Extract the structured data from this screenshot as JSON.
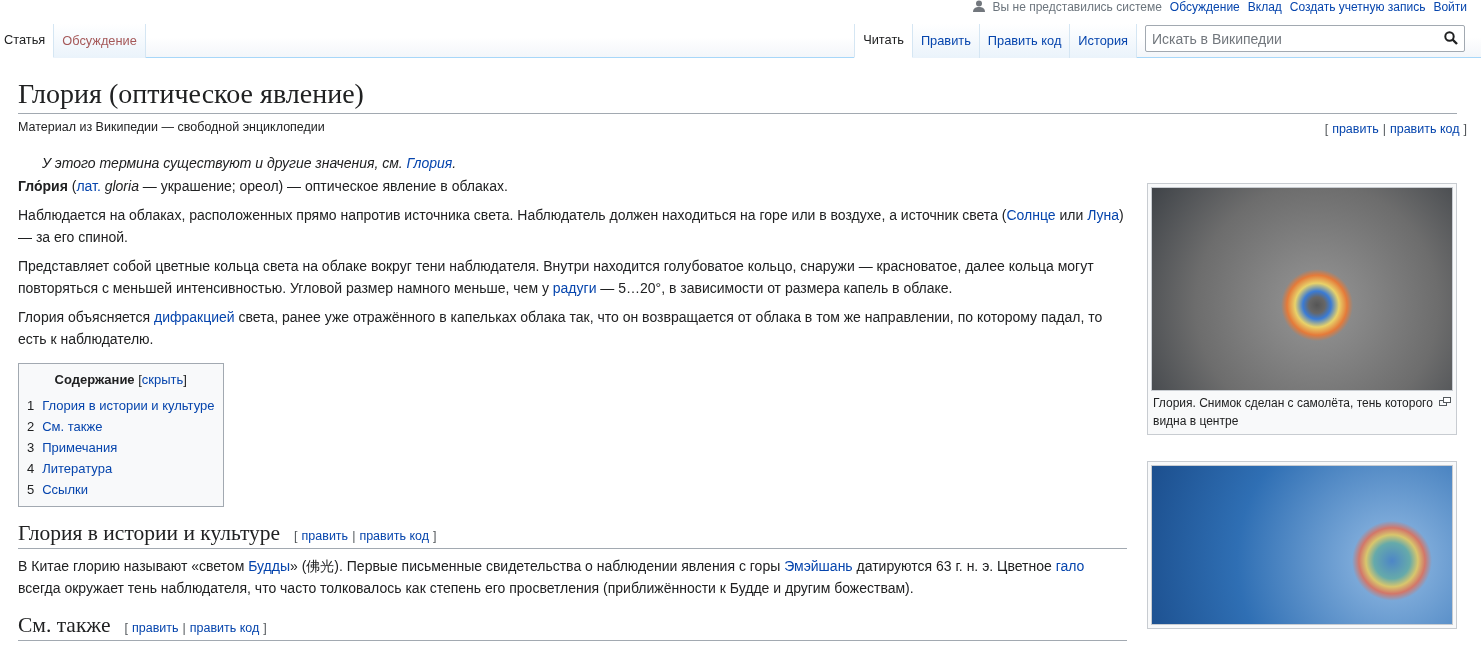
{
  "personal_bar": {
    "status": "Вы не представились системе",
    "links": [
      "Обсуждение",
      "Вклад",
      "Создать учетную запись",
      "Войти"
    ]
  },
  "namespace_tabs": [
    {
      "label": "Статья",
      "selected": true,
      "new_page": false
    },
    {
      "label": "Обсуждение",
      "selected": false,
      "new_page": true
    }
  ],
  "view_tabs": [
    {
      "label": "Читать",
      "selected": true
    },
    {
      "label": "Править",
      "selected": false
    },
    {
      "label": "Править код",
      "selected": false
    },
    {
      "label": "История",
      "selected": false
    }
  ],
  "search": {
    "placeholder": "Искать в Википедии"
  },
  "article": {
    "title": "Глория (оптическое явление)",
    "tagline": "Материал из Википедии — свободной энциклопедии",
    "edit_links": {
      "open": "[",
      "links": [
        "править",
        "править код"
      ],
      "separator": "|",
      "close": "]"
    },
    "hatnote": [
      {
        "kind": "text",
        "text": "У этого термина существуют и другие значения, см. "
      },
      {
        "kind": "link",
        "text": "Глория"
      },
      {
        "kind": "text",
        "text": "."
      }
    ],
    "paragraphs": [
      [
        {
          "kind": "text",
          "text": "**Гло́рия** ("
        },
        {
          "kind": "link",
          "text": "лат."
        },
        {
          "kind": "text",
          "text": " *gloria* — украшение; ореол) — оптическое явление в облаках."
        }
      ],
      [
        {
          "kind": "text",
          "text": "Наблюдается на облаках, расположенных прямо напротив источника света. Наблюдатель должен находиться на горе или в воздухе, а источник света ("
        },
        {
          "kind": "link",
          "text": "Солнце"
        },
        {
          "kind": "text",
          "text": " или "
        },
        {
          "kind": "link",
          "text": "Луна"
        },
        {
          "kind": "text",
          "text": ") — за его спиной."
        }
      ],
      [
        {
          "kind": "text",
          "text": "Представляет собой цветные кольца света на облаке вокруг тени наблюдателя. Внутри находится голубоватое кольцо, снаружи — красноватое, далее кольца могут повторяться с меньшей интенсивностью. Угловой размер намного меньше, чем у "
        },
        {
          "kind": "link",
          "text": "радуги"
        },
        {
          "kind": "text",
          "text": " — 5…20°, в зависимости от размера капель в облаке."
        }
      ],
      [
        {
          "kind": "text",
          "text": "Глория объясняется "
        },
        {
          "kind": "link",
          "text": "дифракцией"
        },
        {
          "kind": "text",
          "text": " света, ранее уже отражённого в капельках облака так, что он возвращается от облака в том же направлении, по которому падал, то есть к наблюдателю."
        }
      ]
    ],
    "toc": {
      "title": "Содержание",
      "open": "[",
      "toggle": "скрыть",
      "close": "]",
      "items": [
        {
          "number": "1",
          "label": "Глория в истории и культуре"
        },
        {
          "number": "2",
          "label": "См. также"
        },
        {
          "number": "3",
          "label": "Примечания"
        },
        {
          "number": "4",
          "label": "Литература"
        },
        {
          "number": "5",
          "label": "Ссылки"
        }
      ]
    },
    "sections": [
      {
        "heading": "Глория в истории и культуре",
        "edit_links": {
          "open": "[",
          "links": [
            "править",
            "править код"
          ],
          "separator": "|",
          "close": "]"
        },
        "paragraphs": [
          [
            {
              "kind": "text",
              "text": "В Китае глорию называют «светом "
            },
            {
              "kind": "link",
              "text": "Будды"
            },
            {
              "kind": "text",
              "text": "» (佛光). Первые письменные свидетельства о наблюдении явления с горы "
            },
            {
              "kind": "link",
              "text": "Эмэйшань"
            },
            {
              "kind": "text",
              "text": " датируются 63 г. н. э. Цветное "
            },
            {
              "kind": "link",
              "text": "гало"
            },
            {
              "kind": "text",
              "text": " всегда окружает тень наблюдателя, что часто толковалось как степень его просветления (приближённости к Будде и другим божествам)."
            }
          ]
        ]
      },
      {
        "heading": "См. также",
        "edit_links": {
          "open": "[",
          "links": [
            "править",
            "править код"
          ],
          "separator": "|",
          "close": "]"
        }
      }
    ]
  },
  "figures": [
    {
      "kind": "aircraft",
      "caption": "Глория. Снимок сделан с самолёта, тень которого видна в центре"
    },
    {
      "kind": "ship"
    }
  ]
}
